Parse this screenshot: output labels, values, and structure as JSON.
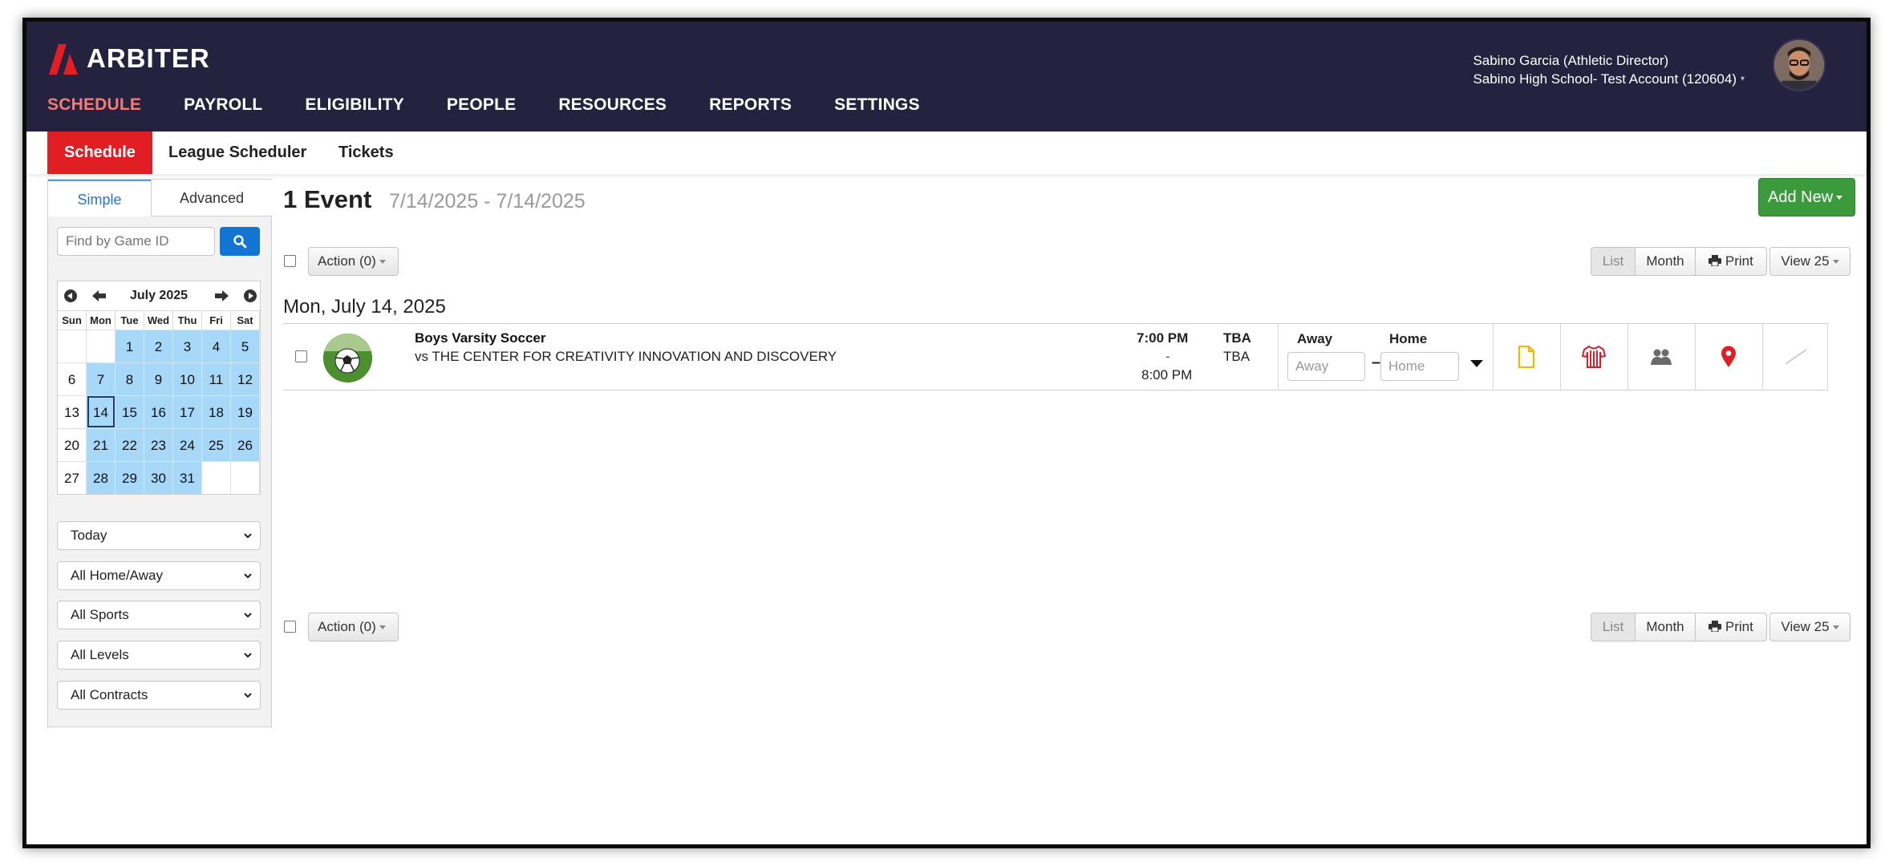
{
  "brand": {
    "name": "ARBITER",
    "accent": "#e21e25"
  },
  "main_nav": [
    {
      "label": "SCHEDULE",
      "active": true
    },
    {
      "label": "PAYROLL"
    },
    {
      "label": "ELIGIBILITY"
    },
    {
      "label": "PEOPLE"
    },
    {
      "label": "RESOURCES"
    },
    {
      "label": "REPORTS"
    },
    {
      "label": "SETTINGS"
    }
  ],
  "user": {
    "name_line": "Sabino Garcia (Athletic Director)",
    "account_line": "Sabino High School- Test Account (120604)"
  },
  "sub_nav": [
    {
      "label": "Schedule",
      "active": true
    },
    {
      "label": "League Scheduler"
    },
    {
      "label": "Tickets"
    }
  ],
  "sidebar": {
    "tabs": [
      "Simple",
      "Advanced"
    ],
    "search_placeholder": "Find by Game ID",
    "calendar": {
      "title": "July 2025",
      "dow": [
        "Sun",
        "Mon",
        "Tue",
        "Wed",
        "Thu",
        "Fri",
        "Sat"
      ],
      "weeks": [
        [
          "",
          "",
          "1",
          "2",
          "3",
          "4",
          "5"
        ],
        [
          "6",
          "7",
          "8",
          "9",
          "10",
          "11",
          "12"
        ],
        [
          "13",
          "14",
          "15",
          "16",
          "17",
          "18",
          "19"
        ],
        [
          "20",
          "21",
          "22",
          "23",
          "24",
          "25",
          "26"
        ],
        [
          "27",
          "28",
          "29",
          "30",
          "31",
          "",
          ""
        ]
      ],
      "today": "14"
    },
    "filters": [
      "Today",
      "All Home/Away",
      "All Sports",
      "All Levels",
      "All Contracts"
    ]
  },
  "main": {
    "event_count": "1 Event",
    "date_range": "7/14/2025 - 7/14/2025",
    "add_new": "Add New",
    "action_label": "Action (0)",
    "view_buttons": {
      "list": "List",
      "month": "Month",
      "print": "Print",
      "view": "View 25"
    },
    "day_heading": "Mon, July 14, 2025",
    "event": {
      "title": "Boys Varsity Soccer",
      "opponent": "vs THE CENTER FOR CREATIVITY INNOVATION AND DISCOVERY",
      "time_start": "7:00 PM",
      "time_sep": "-",
      "time_end": "8:00 PM",
      "venue_1": "TBA",
      "venue_2": "TBA",
      "away_label": "Away",
      "home_label": "Home",
      "away_placeholder": "Away",
      "home_placeholder": "Home",
      "score_sep": "–",
      "icons": [
        "document-icon",
        "jersey-icon",
        "officials-group-icon",
        "location-pin-icon",
        "slash-icon"
      ]
    }
  }
}
